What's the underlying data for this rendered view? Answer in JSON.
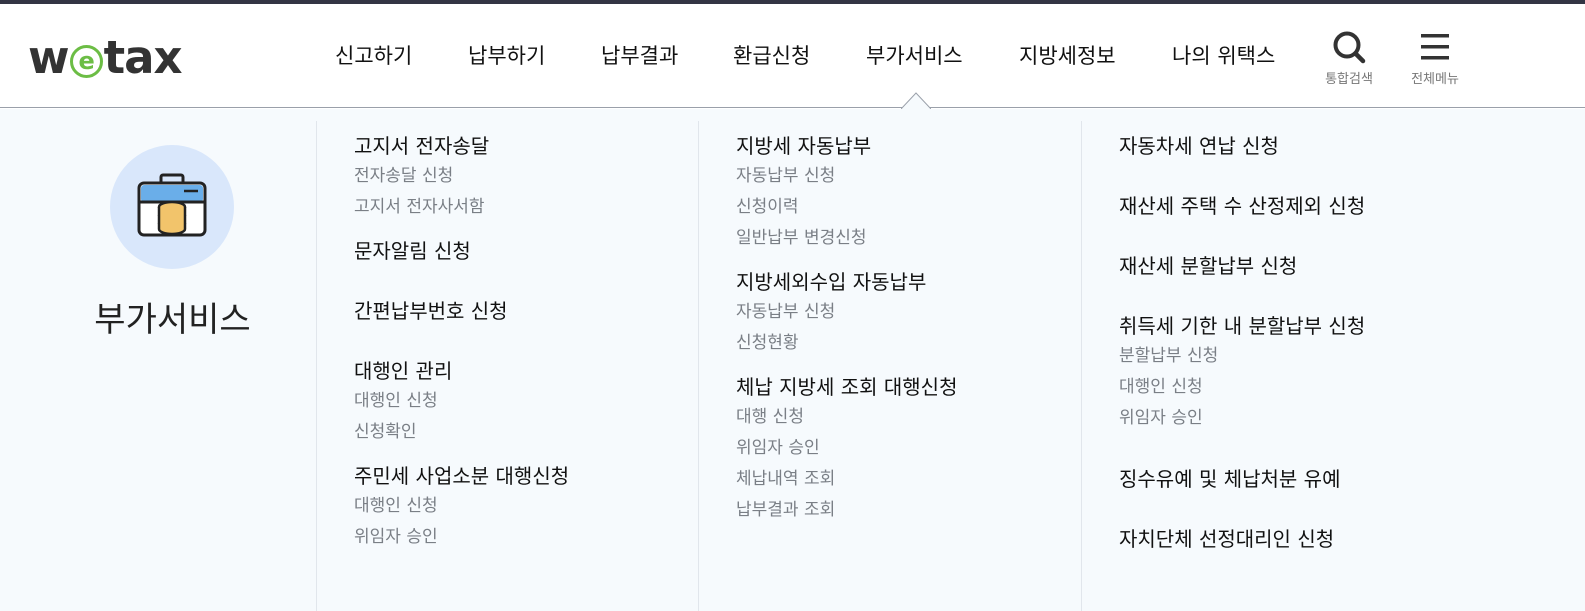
{
  "logo": {
    "w": "w",
    "e": "e",
    "tax": "tax"
  },
  "gnb": [
    "신고하기",
    "납부하기",
    "납부결과",
    "환급신청",
    "부가서비스",
    "지방세정보",
    "나의 위택스"
  ],
  "utility": {
    "search_label": "통합검색",
    "menu_label": "전체메뉴"
  },
  "section": {
    "title": "부가서비스",
    "icon": "briefcase-coins-icon"
  },
  "columns": [
    [
      {
        "title": "고지서 전자송달",
        "items": [
          "전자송달 신청",
          "고지서 전자사서함"
        ]
      },
      {
        "title": "문자알림 신청",
        "items": []
      },
      {
        "title": "간편납부번호 신청",
        "items": []
      },
      {
        "title": "대행인 관리",
        "items": [
          "대행인 신청",
          "신청확인"
        ]
      },
      {
        "title": "주민세 사업소분 대행신청",
        "items": [
          "대행인 신청",
          "위임자 승인"
        ]
      }
    ],
    [
      {
        "title": "지방세 자동납부",
        "items": [
          "자동납부 신청",
          "신청이력",
          "일반납부 변경신청"
        ]
      },
      {
        "title": "지방세외수입 자동납부",
        "items": [
          "자동납부 신청",
          "신청현황"
        ]
      },
      {
        "title": "체납 지방세 조회 대행신청",
        "items": [
          "대행 신청",
          "위임자 승인",
          "체납내역 조회",
          "납부결과 조회"
        ]
      }
    ],
    [
      {
        "title": "자동차세 연납 신청",
        "items": []
      },
      {
        "title": "재산세 주택 수 산정제외 신청",
        "items": []
      },
      {
        "title": "재산세 분할납부 신청",
        "items": []
      },
      {
        "title": "취득세 기한 내 분할납부 신청",
        "items": [
          "분할납부 신청",
          "대행인 신청",
          "위임자 승인"
        ]
      },
      {
        "title": "징수유예 및 체납처분 유예",
        "items": []
      },
      {
        "title": "자치단체 선정대리인 신청",
        "items": []
      }
    ]
  ],
  "colors": {
    "brand_green": "#6cbd45",
    "logo_gray": "#333333",
    "mega_bg": "#f6fafd",
    "badge_bg": "#d9e7fb"
  }
}
